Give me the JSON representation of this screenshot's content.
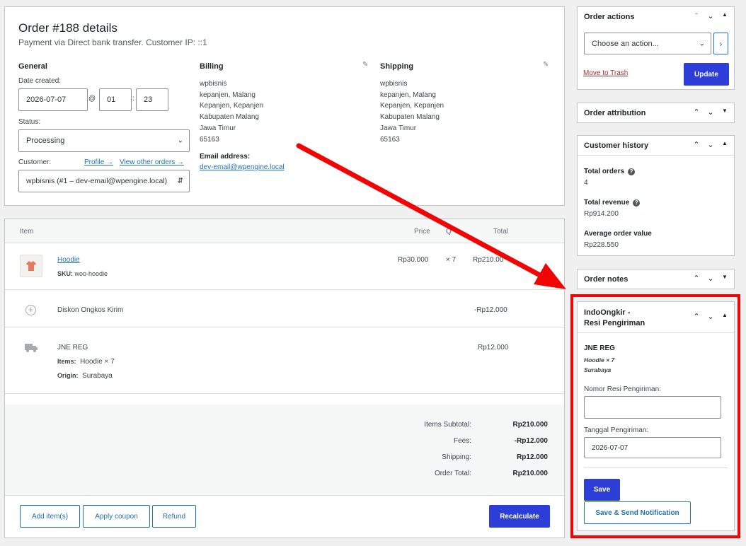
{
  "order": {
    "title": "Order #188 details",
    "subtitle": "Payment via Direct bank transfer. Customer IP: ::1",
    "general": {
      "heading": "General",
      "date_label": "Date created:",
      "date_value": "2026-07-07",
      "at": "@",
      "hour": "01",
      "colon": ":",
      "minute": "23",
      "status_label": "Status:",
      "status_value": "Processing",
      "customer_label": "Customer:",
      "profile_link": "Profile →",
      "other_orders_link": "View other orders →",
      "customer_value": "wpbisnis (#1 – dev-email@wpengine.local)"
    },
    "billing": {
      "heading": "Billing",
      "address": "wpbisnis\nkepanjen, Malang\nKepanjen, Kepanjen\nKabupaten Malang\nJawa Timur\n65163",
      "email_label": "Email address:",
      "email": "dev-email@wpengine.local"
    },
    "shipping": {
      "heading": "Shipping",
      "address": "wpbisnis\nkepanjen, Malang\nKepanjen, Kepanjen\nKabupaten Malang\nJawa Timur\n65163"
    }
  },
  "items": {
    "headers": {
      "item": "Item",
      "price": "Price",
      "qty": "Q",
      "total": "Total"
    },
    "product": {
      "name": "Hoodie",
      "sku_label": "SKU:",
      "sku": "woo-hoodie",
      "price": "Rp30.000",
      "qty": "× 7",
      "total": "Rp210.00"
    },
    "fee": {
      "name": "Diskon Ongkos Kirim",
      "total": "-Rp12.000"
    },
    "shipping": {
      "name": "JNE REG",
      "items_label": "Items:",
      "items": "Hoodie × 7",
      "origin_label": "Origin:",
      "origin": "Surabaya",
      "total": "Rp12.000"
    },
    "totals": [
      {
        "label": "Items Subtotal:",
        "value": "Rp210.000"
      },
      {
        "label": "Fees:",
        "value": "-Rp12.000"
      },
      {
        "label": "Shipping:",
        "value": "Rp12.000"
      },
      {
        "label": "Order Total:",
        "value": "Rp210.000"
      }
    ],
    "buttons": {
      "add_items": "Add item(s)",
      "apply_coupon": "Apply coupon",
      "refund": "Refund",
      "recalculate": "Recalculate"
    }
  },
  "sidebar": {
    "order_actions": {
      "title": "Order actions",
      "select_value": "Choose an action...",
      "trash": "Move to Trash",
      "update": "Update"
    },
    "order_attribution": {
      "title": "Order attribution"
    },
    "customer_history": {
      "title": "Customer history",
      "total_orders_label": "Total orders",
      "total_orders": "4",
      "total_revenue_label": "Total revenue",
      "total_revenue": "Rp914.200",
      "avg_label": "Average order value",
      "avg": "Rp228.550"
    },
    "order_notes": {
      "title": "Order notes"
    },
    "indoongkir": {
      "title_line1": "IndoOngkir -",
      "title_line2": "Resi Pengiriman",
      "courier": "JNE REG",
      "items": "Hoodie × 7",
      "origin": "Surabaya",
      "resi_label": "Nomor Resi Pengiriman:",
      "resi_value": "",
      "date_label": "Tanggal Pengiriman:",
      "date_value": "2026-07-07",
      "save": "Save",
      "save_notify": "Save & Send Notification"
    }
  },
  "colors": {
    "accent": "#2c3dd8",
    "link": "#2271b1",
    "highlight": "#f00404",
    "trash": "#b32d2e"
  },
  "icons": {
    "up": "chevron-up-icon",
    "down": "chevron-down-icon",
    "toggle": "triangle-toggle-icon"
  }
}
